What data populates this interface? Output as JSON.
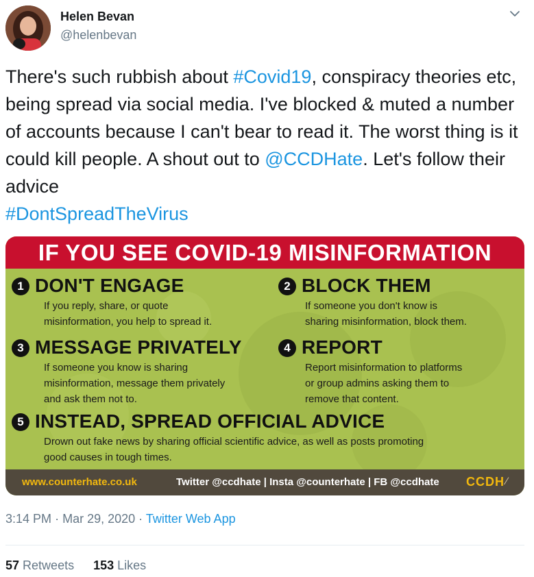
{
  "user": {
    "name": "Helen Bevan",
    "handle": "@helenbevan"
  },
  "tweet": {
    "segments": [
      {
        "text": "There's such rubbish about ",
        "link": false
      },
      {
        "text": "#Covid19",
        "link": true
      },
      {
        "text": ", conspiracy theories etc, being spread via social media. I've blocked & muted a number of accounts because I can't bear to read it. The worst thing is it could kill people. A shout out to ",
        "link": false
      },
      {
        "text": "@CCDHate",
        "link": true
      },
      {
        "text": ". Let's follow their advice ",
        "link": false
      },
      {
        "text": "#DontSpreadTheVirus",
        "link": true
      }
    ]
  },
  "card": {
    "title": "IF YOU SEE COVID-19 MISINFORMATION",
    "tips": [
      {
        "num": "1",
        "heading": "DON'T ENGAGE",
        "lines": [
          "If you reply, share, or quote",
          "misinformation, you help to spread it."
        ]
      },
      {
        "num": "2",
        "heading": "BLOCK THEM",
        "lines": [
          "If someone you don't know is",
          "sharing misinformation, block them."
        ]
      },
      {
        "num": "3",
        "heading": "MESSAGE PRIVATELY",
        "lines": [
          "If someone you know is sharing",
          "misinformation, message them privately",
          "and ask them not to."
        ]
      },
      {
        "num": "4",
        "heading": "REPORT",
        "lines": [
          "Report misinformation to platforms",
          "or group admins asking them to",
          "remove that content."
        ]
      },
      {
        "num": "5",
        "heading": "INSTEAD, SPREAD OFFICIAL ADVICE",
        "lines": [
          "Drown out fake news by sharing official scientific advice, as well as posts promoting",
          "good causes in tough times."
        ]
      }
    ],
    "footer": {
      "url": "www.counterhate.co.uk",
      "social": "Twitter @ccdhate | Insta @counterhate | FB @ccdhate",
      "logo": "CCDH"
    }
  },
  "meta": {
    "time": "3:14 PM",
    "separator": "·",
    "date": "Mar 29, 2020",
    "app": "Twitter Web App"
  },
  "stats": {
    "retweets_count": "57",
    "retweets_label": "Retweets",
    "likes_count": "153",
    "likes_label": "Likes"
  },
  "icons": {
    "more": "chevron-down-icon"
  },
  "colors": {
    "link": "#1b95e0",
    "header_red": "#c8102e",
    "card_green": "#a7c04e",
    "footer_brown": "#51493d",
    "footer_gold": "#f2b80e"
  }
}
